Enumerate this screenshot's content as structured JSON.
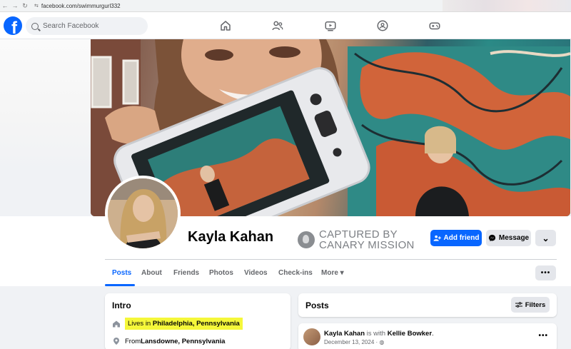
{
  "browser": {
    "url": "facebook.com/swimmurgurl332"
  },
  "topnav": {
    "logo": "f",
    "search_placeholder": "Search Facebook",
    "icons": [
      "home-icon",
      "friends-icon",
      "watch-icon",
      "groups-icon",
      "gaming-icon"
    ]
  },
  "profile": {
    "name": "Kayla Kahan",
    "watermark_line1": "CAPTURED BY",
    "watermark_line2": "CANARY MISSION",
    "add_friend": "Add friend",
    "message": "Message",
    "more_caret": "⌄"
  },
  "tabs": [
    {
      "label": "Posts"
    },
    {
      "label": "About"
    },
    {
      "label": "Friends"
    },
    {
      "label": "Photos"
    },
    {
      "label": "Videos"
    },
    {
      "label": "Check-ins"
    },
    {
      "label": "More ▾"
    }
  ],
  "tabs_more_button": "•••",
  "intro": {
    "title": "Intro",
    "lives_prefix": "Lives in ",
    "lives_place": "Philadelphia, Pennsylvania",
    "from_prefix": "From ",
    "from_place": "Lansdowne, Pennsylvania"
  },
  "posts": {
    "title": "Posts",
    "filters": "Filters",
    "item": {
      "author": "Kayla Kahan",
      "is_with": " is with ",
      "tagged": "Kellie Bowker",
      "end": ".",
      "date": "December 13, 2024 · ",
      "more": "•••"
    }
  },
  "colors": {
    "brand": "#0866ff",
    "highlight": "#f5f73a",
    "background": "#f0f2f5"
  }
}
